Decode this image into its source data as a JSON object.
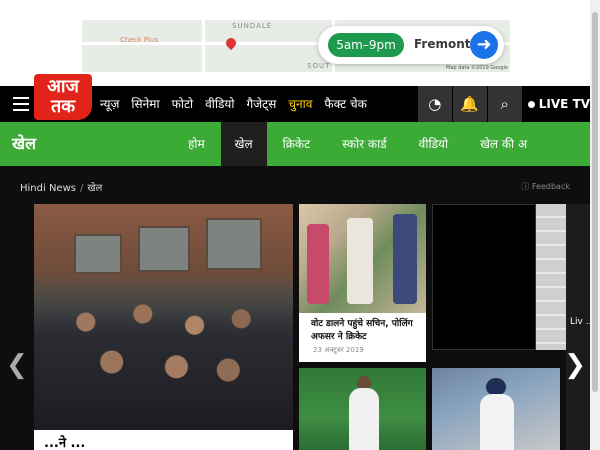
{
  "ad": {
    "street_top": "SUNDALE",
    "street_bottom": "SOUT",
    "place": "Check Plus",
    "time": "5am–9pm",
    "destination": "Fremont",
    "attribution": "Map data ©2019 Google"
  },
  "header": {
    "logo_line1": "आज",
    "logo_line2": "तक",
    "nav": [
      {
        "label": "न्यूज़",
        "highlight": false
      },
      {
        "label": "सिनेमा",
        "highlight": false
      },
      {
        "label": "फोटो",
        "highlight": false
      },
      {
        "label": "वीडियो",
        "highlight": false
      },
      {
        "label": "गैजेट्स",
        "highlight": false
      },
      {
        "label": "चुनाव",
        "highlight": true
      },
      {
        "label": "फैक्ट चेक",
        "highlight": false
      }
    ],
    "live_label": "LIVE TV"
  },
  "section": {
    "title": "खेल",
    "tabs": [
      {
        "label": "होम",
        "active": false
      },
      {
        "label": "खेल",
        "active": true
      },
      {
        "label": "क्रिकेट",
        "active": false
      },
      {
        "label": "स्कोर कार्ड",
        "active": false
      },
      {
        "label": "वीडियो",
        "active": false
      },
      {
        "label": "खेल की अ",
        "active": false
      }
    ]
  },
  "breadcrumb": {
    "root": "Hindi News",
    "separator": "/",
    "current": "खेल"
  },
  "feedback_label": "Feedback",
  "hero": {
    "caption": "...ने ..."
  },
  "cards": {
    "card1_title": "वोट डालने पहुंचे सचिन, पोलिंग अफसर ने क्रिकेट",
    "card1_date": "23 अक्टूबर 2019",
    "peek_text": "Liv ..."
  },
  "colors": {
    "brand_red": "#e2231a",
    "nav_black": "#000000",
    "section_green": "#3bab36",
    "highlight_yellow": "#ffd200"
  }
}
